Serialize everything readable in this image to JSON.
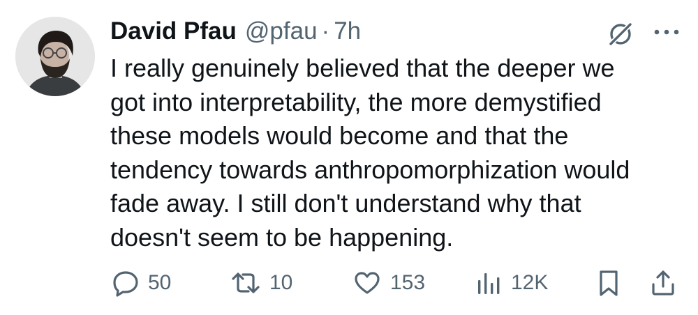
{
  "author": {
    "name": "David Pfau",
    "handle": "@pfau",
    "separator": "·",
    "time": "7h"
  },
  "tweet": {
    "lines": [
      "I really genuinely believed that the deeper we",
      "got into interpretability, the more demystified",
      "these models would become and that the",
      "tendency towards anthropomorphization would",
      "fade away. I still don't understand why that",
      "doesn't seem to be happening."
    ]
  },
  "actions": {
    "replies": "50",
    "reposts": "10",
    "likes": "153",
    "views": "12K"
  },
  "icons": {
    "reply": "reply-icon",
    "repost": "repost-icon",
    "like": "heart-icon",
    "views": "views-icon",
    "bookmark": "bookmark-icon",
    "share": "share-icon",
    "grok": "grok-icon",
    "more": "more-icon"
  },
  "colors": {
    "text": "#0f1419",
    "secondary": "#536471",
    "background": "#ffffff"
  }
}
